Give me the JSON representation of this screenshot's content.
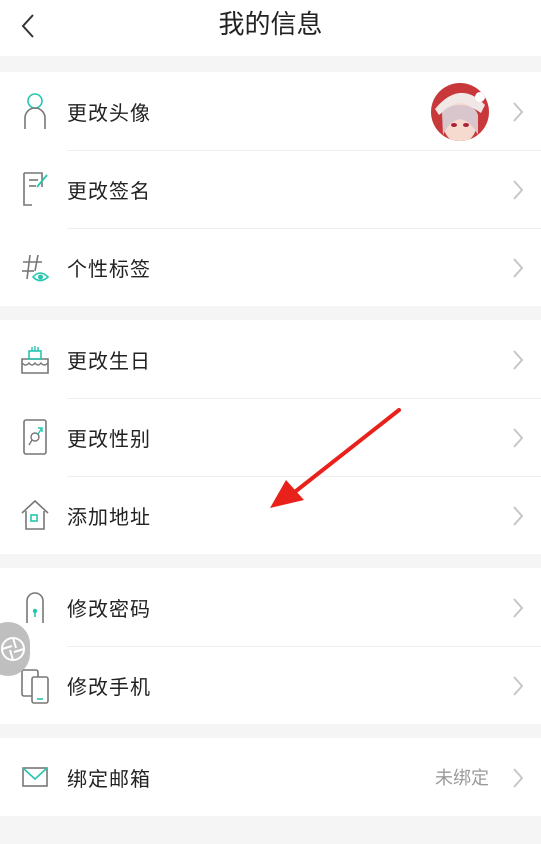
{
  "header": {
    "title": "我的信息"
  },
  "groups": [
    {
      "items": [
        {
          "label": "更改头像",
          "icon": "user-icon",
          "trailing": "avatar"
        },
        {
          "label": "更改签名",
          "icon": "signature-icon"
        },
        {
          "label": "个性标签",
          "icon": "hashtag-icon"
        }
      ]
    },
    {
      "items": [
        {
          "label": "更改生日",
          "icon": "birthday-cake-icon"
        },
        {
          "label": "更改性别",
          "icon": "gender-icon"
        },
        {
          "label": "添加地址",
          "icon": "house-icon"
        }
      ]
    },
    {
      "items": [
        {
          "label": "修改密码",
          "icon": "lock-icon"
        },
        {
          "label": "修改手机",
          "icon": "phone-icon"
        }
      ]
    },
    {
      "items": [
        {
          "label": "绑定邮箱",
          "icon": "envelope-icon",
          "value": "未绑定"
        }
      ]
    }
  ],
  "colors": {
    "accent": "#26c6b0",
    "annotation_arrow": "#e8221b",
    "icon_stroke": "#777777"
  }
}
